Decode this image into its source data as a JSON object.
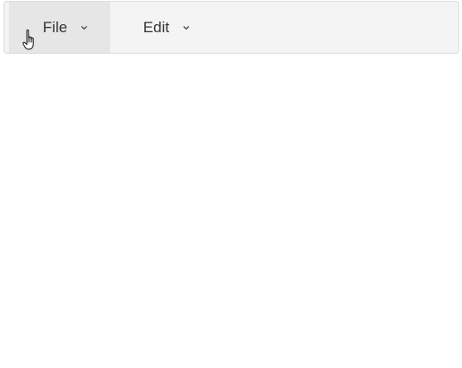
{
  "menubar": {
    "items": [
      {
        "label": "File",
        "icon": "chevron-down-icon",
        "state": "hover"
      },
      {
        "label": "Edit",
        "icon": "chevron-down-icon",
        "state": "normal"
      }
    ]
  },
  "cursor": {
    "icon": "hand-pointer-icon"
  },
  "colors": {
    "menubar_bg": "#f4f4f4",
    "menubar_border": "#dcdcdc",
    "hover_bg": "#e6e6e6",
    "text": "#333333"
  }
}
